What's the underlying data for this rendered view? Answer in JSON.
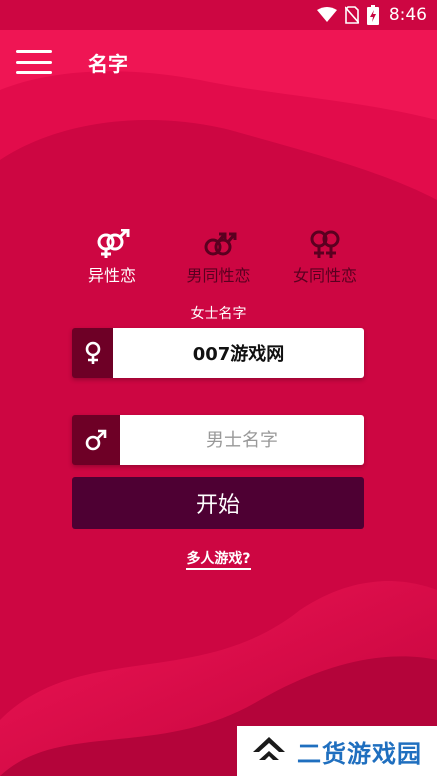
{
  "status_bar": {
    "time": "8:46",
    "icons": [
      "wifi-icon",
      "no-sim-icon",
      "battery-charging-icon"
    ]
  },
  "app_bar": {
    "title": "名字",
    "menu_icon": "hamburger-menu-icon"
  },
  "mode_tabs": [
    {
      "label": "异性恋",
      "icon": "hetero-symbol-icon",
      "active": true
    },
    {
      "label": "男同性恋",
      "icon": "gay-male-symbol-icon",
      "active": false
    },
    {
      "label": "女同性恋",
      "icon": "lesbian-symbol-icon",
      "active": false
    }
  ],
  "section_label": "女士名字",
  "female_field": {
    "icon": "female-symbol-icon",
    "value": "007游戏网"
  },
  "male_field": {
    "icon": "male-symbol-icon",
    "value": "",
    "placeholder": "男士名字"
  },
  "start_button": {
    "label": "开始"
  },
  "multiplayer_link": {
    "label": "多人游戏?"
  },
  "watermark": {
    "text": "二货游戏园"
  },
  "colors": {
    "background": "#c8053f",
    "icon_box": "#6e0026",
    "start_button": "#4e0033",
    "inactive_tab": "#5a0020",
    "watermark_text": "#1f6fbf"
  }
}
